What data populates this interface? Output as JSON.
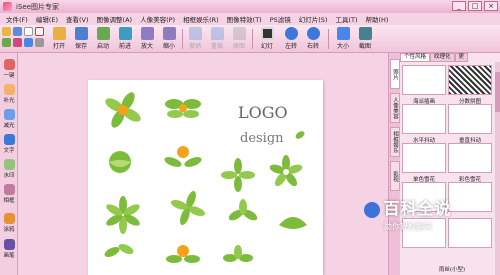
{
  "window": {
    "title": "iSee图片专家",
    "controls": [
      "_",
      "□",
      "×"
    ]
  },
  "menu": [
    "文件(F)",
    "编辑(E)",
    "查看(V)",
    "图像调整(A)",
    "人像美容(P)",
    "相框娱乐(R)",
    "图像特效(T)",
    "PS滤镜",
    "幻灯片(S)",
    "工具(T)",
    "帮助(H)"
  ],
  "toolbar": {
    "buttons": [
      {
        "label": "打开",
        "icon": "folder-icon",
        "enabled": true
      },
      {
        "label": "保存",
        "icon": "save-icon",
        "enabled": true
      },
      {
        "label": "启动",
        "icon": "launch-icon",
        "enabled": true
      },
      {
        "label": "前进",
        "icon": "forward-icon",
        "enabled": true
      },
      {
        "label": "放大",
        "icon": "zoom-in-icon",
        "enabled": true
      },
      {
        "label": "缩小",
        "icon": "zoom-out-icon",
        "enabled": true
      },
      {
        "label": "撤销",
        "icon": "undo-icon",
        "enabled": false
      },
      {
        "label": "重做",
        "icon": "redo-icon",
        "enabled": false
      },
      {
        "label": "原图",
        "icon": "original-icon",
        "enabled": false
      },
      {
        "label": "幻灯",
        "icon": "slideshow-icon",
        "enabled": true
      },
      {
        "label": "左转",
        "icon": "rotate-left-icon",
        "enabled": true
      },
      {
        "label": "右转",
        "icon": "rotate-right-icon",
        "enabled": true
      },
      {
        "label": "大小",
        "icon": "resize-icon",
        "enabled": true
      },
      {
        "label": "截图",
        "icon": "screenshot-icon",
        "enabled": true
      }
    ]
  },
  "left_tools": [
    {
      "label": "一键",
      "icon": "magic-icon"
    },
    {
      "label": "补光",
      "icon": "light-icon"
    },
    {
      "label": "减光",
      "icon": "dim-icon"
    },
    {
      "label": "文字",
      "icon": "text-icon"
    },
    {
      "label": "水印",
      "icon": "watermark-icon"
    },
    {
      "label": "相框",
      "icon": "frame-icon"
    },
    {
      "label": "涂鸦",
      "icon": "brush-icon"
    },
    {
      "label": "画笔",
      "icon": "pen-icon"
    }
  ],
  "canvas": {
    "logo_text": "LOGO",
    "design_text": "design"
  },
  "side_tabs": [
    "照片",
    "人像美容",
    "相框娱乐",
    "影视"
  ],
  "right_panel": {
    "tabs": [
      "个性风格",
      "纹理化",
      "更"
    ],
    "templates": [
      "海派插画",
      "分数拼图",
      "水平抖动",
      "垂直抖动",
      "单色雪花",
      "彩色雪花",
      "雨丝(小型)"
    ]
  },
  "watermark": {
    "main": "百科全说",
    "sub": "助你轻松解决"
  },
  "colors": {
    "brand_pink": "#f0c8dc",
    "leaf_green": "#7dbb3a",
    "orange": "#f5a21b"
  }
}
